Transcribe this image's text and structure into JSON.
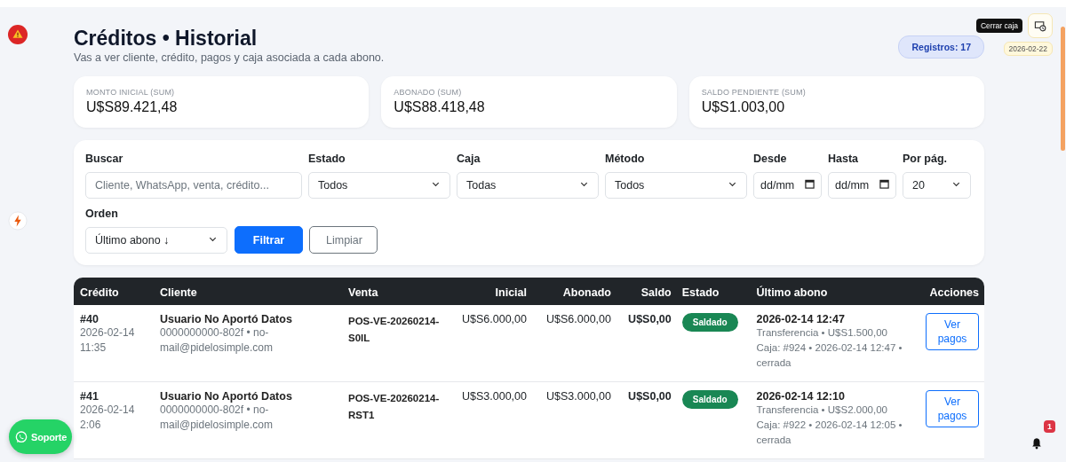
{
  "header": {
    "title": "Créditos • Historial",
    "subtitle": "Vas a ver cliente, crédito, pagos y caja asociada a cada abono.",
    "records_badge": "Registros: 17"
  },
  "cash_widget": {
    "tooltip": "Cerrar caja",
    "date": "2026-02-22"
  },
  "stats": [
    {
      "label": "MONTO INICIAL (SUM)",
      "value": "U$S89.421,48"
    },
    {
      "label": "ABONADO (SUM)",
      "value": "U$S88.418,48"
    },
    {
      "label": "SALDO PENDIENTE (SUM)",
      "value": "U$S1.003,00"
    }
  ],
  "filters": [
    {
      "kind": "text",
      "label": "Buscar",
      "placeholder": "Cliente, WhatsApp, venta, crédito..."
    },
    {
      "kind": "select",
      "label": "Estado",
      "value": "Todos"
    },
    {
      "kind": "select",
      "label": "Caja",
      "value": "Todas"
    },
    {
      "kind": "select",
      "label": "Método",
      "value": "Todos"
    },
    {
      "kind": "date",
      "label": "Desde",
      "placeholder": "dd/mm"
    },
    {
      "kind": "date",
      "label": "Hasta",
      "placeholder": "dd/mm"
    },
    {
      "kind": "select",
      "label": "Por pág.",
      "value": "20"
    },
    {
      "kind": "select",
      "label": "Orden",
      "value": "Último abono ↓"
    }
  ],
  "buttons": [
    {
      "kind": "primary",
      "label": "Filtrar"
    },
    {
      "kind": "secondary",
      "label": "Limpiar"
    }
  ],
  "table": {
    "columns": [
      "Crédito",
      "Cliente",
      "Venta",
      "Inicial",
      "Abonado",
      "Saldo",
      "Estado",
      "Último abono",
      "Acciones"
    ],
    "rows": [
      {
        "credit": "#40",
        "credit_date": "2026-02-14",
        "credit_time": "11:35",
        "client": "Usuario No Aportó Datos",
        "client_contact": "0000000000-802f • no-mail@pidelosimple.com",
        "sale": "POS-VE-20260214-S0IL",
        "initial": "U$S6.000,00",
        "paid": "U$S6.000,00",
        "balance": "U$S0,00",
        "status": "Saldado",
        "last_payment": "2026-02-14 12:47",
        "payment_detail": "Transferencia • U$S1.500,00",
        "cash_detail": "Caja: #924 • 2026-02-14 12:47 • cerrada",
        "action": "Ver pagos"
      },
      {
        "credit": "#41",
        "credit_date": "2026-02-14",
        "credit_time": "2:06",
        "client": "Usuario No Aportó Datos",
        "client_contact": "0000000000-802f • no-mail@pidelosimple.com",
        "sale": "POS-VE-20260214-RST1",
        "initial": "U$S3.000,00",
        "paid": "U$S3.000,00",
        "balance": "U$S0,00",
        "status": "Saldado",
        "last_payment": "2026-02-14 12:10",
        "payment_detail": "Transferencia • U$S2.000,00",
        "cash_detail": "Caja: #922 • 2026-02-14 12:05 • cerrada",
        "action": "Ver pagos"
      }
    ]
  },
  "support_button": {
    "label": "Soporte"
  },
  "notifications": {
    "count": "1"
  }
}
